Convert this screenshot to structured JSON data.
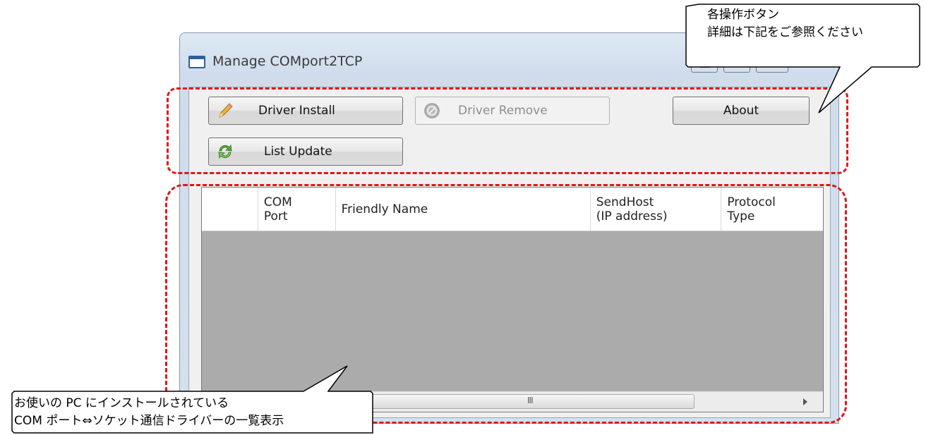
{
  "window": {
    "title": "Manage COMport2TCP",
    "close_glyph": "✕"
  },
  "toolbar": {
    "driver_install": "Driver Install",
    "driver_remove": "Driver Remove",
    "about": "About",
    "list_update": "List Update"
  },
  "list": {
    "columns": [
      "",
      "COM\nPort",
      "Friendly Name",
      "SendHost\n(IP address)",
      "Protocol\nType"
    ],
    "rows": [],
    "scroll_grip": "III"
  },
  "annotations": {
    "top_callout": [
      "各操作ボタン",
      "詳細は下記をご参照ください"
    ],
    "bottom_callout": [
      "お使いの PC にインストールされている",
      "COM ポート⇔ソケット通信ドライバーの一覧表示"
    ],
    "highlight_color": "#e0161b"
  },
  "icons": {
    "install": "pencil-icon",
    "remove": "prohibited-icon",
    "update": "refresh-icon",
    "app": "window-icon"
  }
}
